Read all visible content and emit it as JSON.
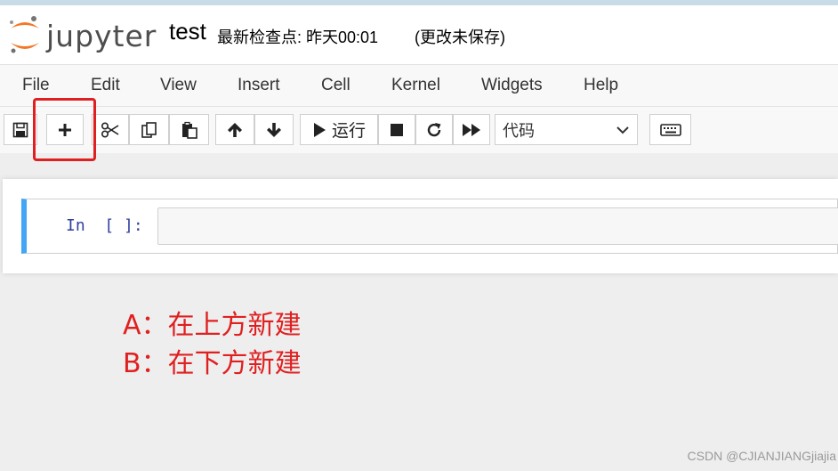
{
  "header": {
    "logo_text": "jupyter",
    "notebook_name": "test",
    "checkpoint": "最新检查点: 昨天00:01",
    "autosave_status": "(更改未保存)"
  },
  "menu": {
    "items": [
      "File",
      "Edit",
      "View",
      "Insert",
      "Cell",
      "Kernel",
      "Widgets",
      "Help"
    ]
  },
  "toolbar": {
    "run_label": "运行",
    "cell_type_selected": "代码"
  },
  "cell": {
    "prompt": "In  [ ]:"
  },
  "annotations": {
    "line_a": "A：在上方新建",
    "line_b": "B：在下方新建"
  },
  "watermark": "CSDN @CJIANJIANGjiajia",
  "colors": {
    "logo_orange": "#f37726",
    "cell_selected_border": "#42a5f5",
    "annotation_red": "#e02020",
    "prompt_blue": "#303f9f"
  }
}
